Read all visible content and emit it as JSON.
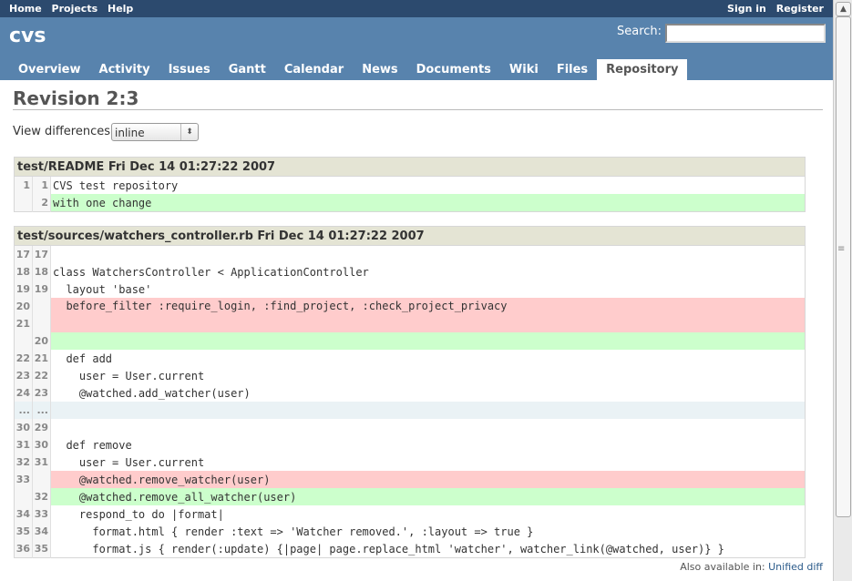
{
  "topmenu": {
    "left": [
      "Home",
      "Projects",
      "Help"
    ],
    "right": [
      "Sign in",
      "Register"
    ]
  },
  "header": {
    "project": "cvs",
    "search_label": "Search:",
    "search_value": ""
  },
  "tabs": [
    "Overview",
    "Activity",
    "Issues",
    "Gantt",
    "Calendar",
    "News",
    "Documents",
    "Wiki",
    "Files",
    "Repository"
  ],
  "selected_tab": "Repository",
  "page": {
    "title": "Revision 2:3",
    "view_label": "View differences",
    "view_value": "inline"
  },
  "diffs": [
    {
      "filename": "test/README Fri Dec 14 01:27:22 2007",
      "rows": [
        {
          "old": "1",
          "new": "1",
          "code": "CVS test repository",
          "type": "ctx"
        },
        {
          "old": "",
          "new": "2",
          "code": "with one change",
          "type": "add"
        }
      ]
    },
    {
      "filename": "test/sources/watchers_controller.rb Fri Dec 14 01:27:22 2007",
      "rows": [
        {
          "old": "17",
          "new": "17",
          "code": "",
          "type": "ctx"
        },
        {
          "old": "18",
          "new": "18",
          "code": "class WatchersController < ApplicationController",
          "type": "ctx"
        },
        {
          "old": "19",
          "new": "19",
          "code": "  layout 'base'",
          "type": "ctx"
        },
        {
          "old": "20",
          "old2": "21",
          "new": "",
          "code": "  before_filter :require_login, :find_project, :check_project_privacy",
          "type": "del2"
        },
        {
          "old": "",
          "new": "20",
          "code": "",
          "type": "add"
        },
        {
          "old": "22",
          "new": "21",
          "code": "  def add",
          "type": "ctx"
        },
        {
          "old": "23",
          "new": "22",
          "code": "    user = User.current",
          "type": "ctx"
        },
        {
          "old": "24",
          "new": "23",
          "code": "    @watched.add_watcher(user)",
          "type": "ctx"
        },
        {
          "old": "...",
          "new": "...",
          "code": "",
          "type": "sep"
        },
        {
          "old": "30",
          "new": "29",
          "code": "",
          "type": "ctx"
        },
        {
          "old": "31",
          "new": "30",
          "code": "  def remove",
          "type": "ctx"
        },
        {
          "old": "32",
          "new": "31",
          "code": "    user = User.current",
          "type": "ctx"
        },
        {
          "old": "33",
          "new": "",
          "code": "    @watched.remove_watcher(user)",
          "type": "del"
        },
        {
          "old": "",
          "new": "32",
          "code": "    @watched.remove_all_watcher(user)",
          "type": "add"
        },
        {
          "old": "34",
          "new": "33",
          "code": "    respond_to do |format|",
          "type": "ctx"
        },
        {
          "old": "35",
          "new": "34",
          "code": "      format.html { render :text => 'Watcher removed.', :layout => true }",
          "type": "ctx"
        },
        {
          "old": "36",
          "new": "35",
          "code": "      format.js { render(:update) {|page| page.replace_html 'watcher', watcher_link(@watched, user)} }",
          "type": "ctx"
        }
      ]
    }
  ],
  "footer": {
    "text": "Also available in: ",
    "link": "Unified diff"
  }
}
